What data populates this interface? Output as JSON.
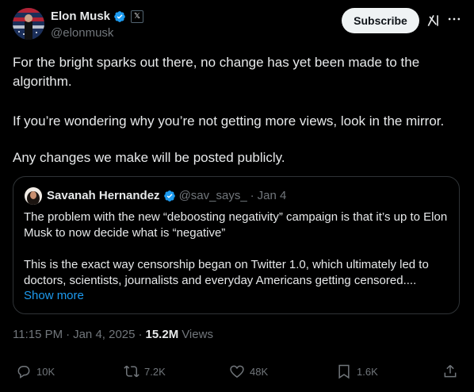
{
  "author": {
    "name": "Elon Musk",
    "handle": "@elonmusk",
    "verified_icon": "verified-badge-icon",
    "affiliation_icon": "x-logo-icon",
    "affiliation_text": "𝕏"
  },
  "header": {
    "subscribe_label": "Subscribe",
    "grok_icon": "grok-icon",
    "more_icon": "more-icon"
  },
  "tweet": {
    "paragraphs": [
      "For the bright sparks out there, no change has yet been made to the algorithm.",
      "If you’re wondering why you’re not getting more views, look in the mirror.",
      "Any changes we make will be posted publicly."
    ]
  },
  "quote": {
    "name": "Savanah Hernandez",
    "handle": "@sav_says_",
    "separator": "·",
    "date": "Jan 4",
    "paragraphs": [
      "The problem with the new “deboosting negativity” campaign is that it’s up to Elon Musk to now decide what is “negative”",
      "This is the exact way censorship began on Twitter 1.0, which ultimately led to doctors, scientists, journalists and everyday Americans getting censored...."
    ],
    "show_more": "Show more"
  },
  "meta": {
    "time": "11:15 PM",
    "separator1": "·",
    "date": "Jan 4, 2025",
    "separator2": "·",
    "views_count": "15.2M",
    "views_label": "Views"
  },
  "actions": {
    "replies": "10K",
    "reposts": "7.2K",
    "likes": "48K",
    "bookmarks": "1.6K"
  },
  "colors": {
    "background": "#000000",
    "text": "#e7e9ea",
    "secondary": "#71767b",
    "link": "#1d9bf0",
    "border": "#2f3336",
    "verified": "#1d9bf0"
  }
}
